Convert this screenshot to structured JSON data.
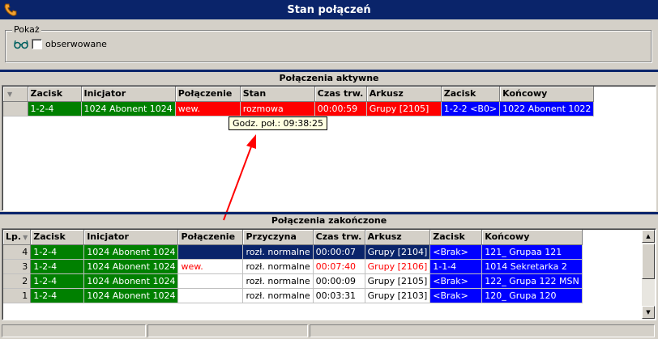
{
  "window": {
    "title": "Stan połączeń"
  },
  "filter": {
    "group_label": "Pokaż",
    "observed_label": "obserwowane",
    "observed_checked": false
  },
  "active": {
    "title": "Połączenia aktywne",
    "columns": [
      "",
      "Zacisk",
      "Inicjator",
      "Połączenie",
      "Stan",
      "Czas trw.",
      "Arkusz",
      "Zacisk",
      "Końcowy"
    ],
    "rows": [
      {
        "zacisk": "1-2-4",
        "inicjator": "1024 Abonent 1024",
        "polaczenie": "wew.",
        "stan": "rozmowa",
        "czas": "00:00:59",
        "arkusz": "Grupy [2105]",
        "zacisk2": "1-2-2 <B0>",
        "koncowy": "1022 Abonent 1022"
      }
    ],
    "tooltip": "Godz. poł.: 09:38:25"
  },
  "finished": {
    "title": "Połączenia zakończone",
    "columns": [
      "Lp.",
      "Zacisk",
      "Inicjator",
      "Połączenie",
      "Przyczyna",
      "Czas trw.",
      "Arkusz",
      "Zacisk",
      "Końcowy"
    ],
    "rows": [
      {
        "lp": "4",
        "zacisk": "1-2-4",
        "inicjator": "1024 Abonent 1024",
        "polaczenie": "",
        "przyczyna": "rozł. normalne",
        "czas": "00:00:07",
        "arkusz": "Grupy [2104]",
        "zacisk2": "<Brak>",
        "koncowy": "121_ Grupaa 121"
      },
      {
        "lp": "3",
        "zacisk": "1-2-4",
        "inicjator": "1024 Abonent 1024",
        "polaczenie": "wew.",
        "przyczyna": "rozł. normalne",
        "czas": "00:07:40",
        "arkusz": "Grupy [2106]",
        "zacisk2": "1-1-4",
        "koncowy": "1014 Sekretarka 2"
      },
      {
        "lp": "2",
        "zacisk": "1-2-4",
        "inicjator": "1024 Abonent 1024",
        "polaczenie": "",
        "przyczyna": "rozł. normalne",
        "czas": "00:00:09",
        "arkusz": "Grupy [2105]",
        "zacisk2": "<Brak>",
        "koncowy": "122_ Grupa 122  MSN"
      },
      {
        "lp": "1",
        "zacisk": "1-2-4",
        "inicjator": "1024 Abonent 1024",
        "polaczenie": "",
        "przyczyna": "rozł. normalne",
        "czas": "00:03:31",
        "arkusz": "Grupy [2103]",
        "zacisk2": "<Brak>",
        "koncowy": "120_ Grupa 120"
      }
    ]
  },
  "colors": {
    "title_bar": "#0a246a",
    "green": "#008000",
    "red": "#ff0000",
    "blue": "#0000ff"
  }
}
